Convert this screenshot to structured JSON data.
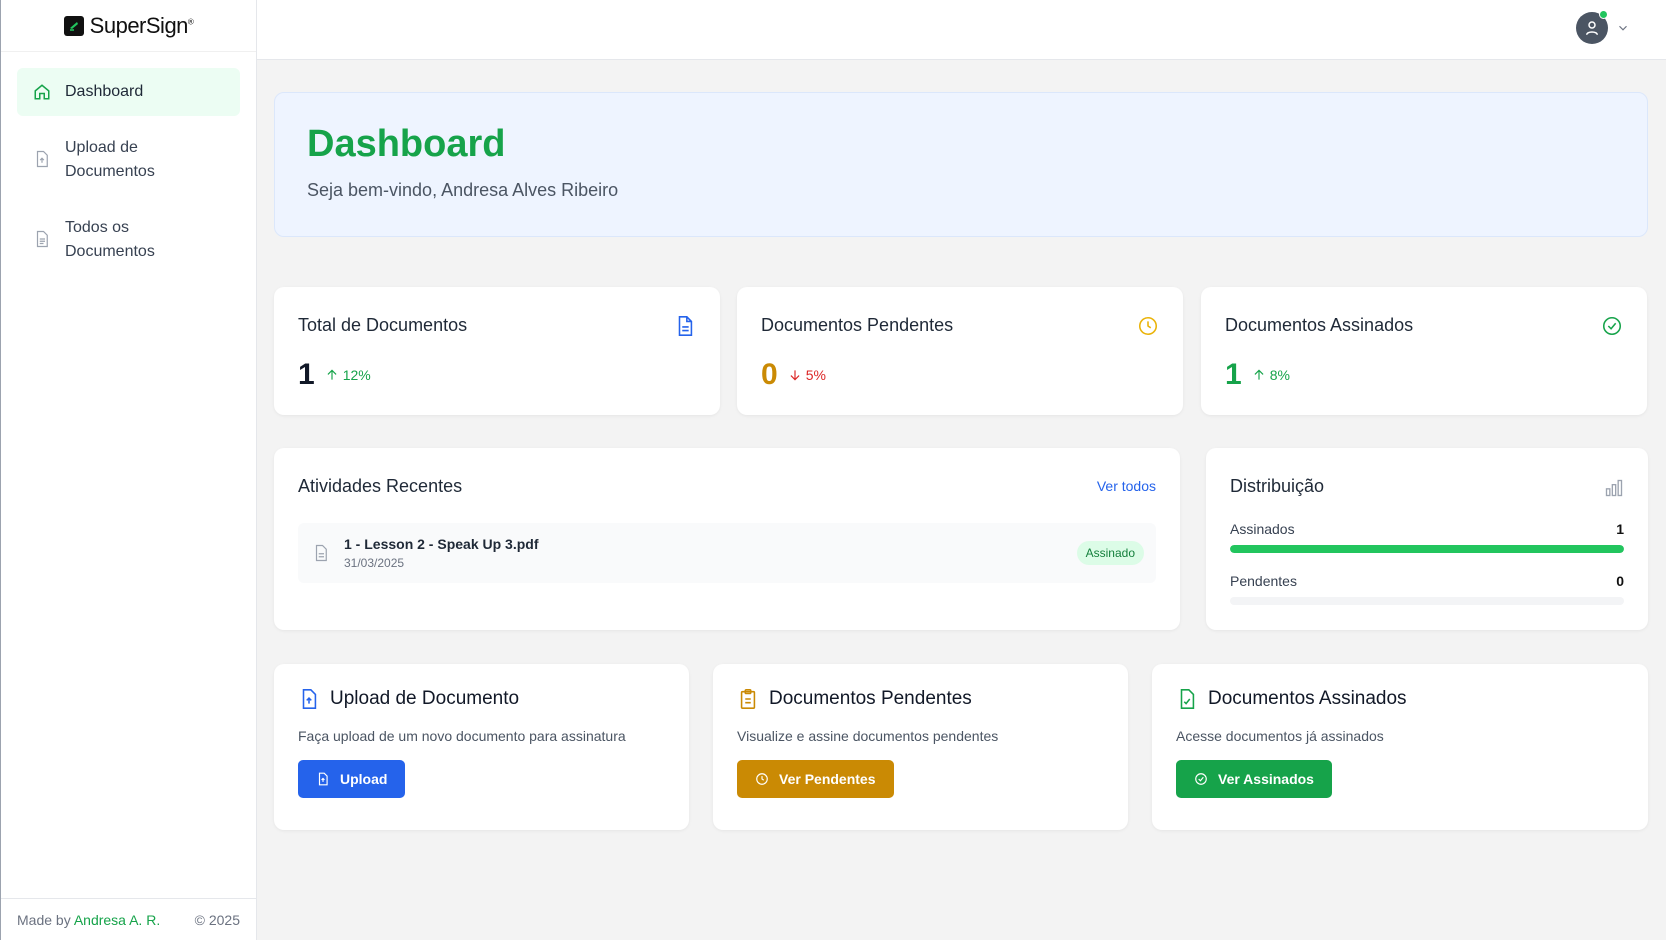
{
  "app": {
    "logo_text": "SuperSign",
    "logo_mark": "®"
  },
  "sidebar": {
    "items": [
      {
        "label": "Dashboard",
        "icon": "home-icon",
        "active": true
      },
      {
        "label": "Upload de Documentos",
        "icon": "file-upload-icon",
        "active": false
      },
      {
        "label": "Todos os Documentos",
        "icon": "file-text-icon",
        "active": false
      }
    ],
    "footer": {
      "made_by": "Made by",
      "author": "Andresa A. R.",
      "copyright": "© 2025"
    }
  },
  "hero": {
    "title": "Dashboard",
    "subtitle": "Seja bem-vindo, Andresa Alves Ribeiro"
  },
  "stats": [
    {
      "title": "Total de Documentos",
      "value": "1",
      "trend": "12%",
      "direction": "up",
      "value_color": "#111827",
      "trend_color": "#16a34a",
      "icon": "document-icon"
    },
    {
      "title": "Documentos Pendentes",
      "value": "0",
      "trend": "5%",
      "direction": "down",
      "value_color": "#ca8a04",
      "trend_color": "#dc2626",
      "icon": "clock-icon"
    },
    {
      "title": "Documentos Assinados",
      "value": "1",
      "trend": "8%",
      "direction": "up",
      "value_color": "#16a34a",
      "trend_color": "#16a34a",
      "icon": "check-circle-icon"
    }
  ],
  "activity": {
    "title": "Atividades Recentes",
    "view_all": "Ver todos",
    "items": [
      {
        "name": "1 - Lesson 2 - Speak Up 3.pdf",
        "date": "31/03/2025",
        "status": "Assinado"
      }
    ]
  },
  "distribution": {
    "title": "Distribuição",
    "rows": [
      {
        "label": "Assinados",
        "value": "1",
        "fraction": 1.0
      },
      {
        "label": "Pendentes",
        "value": "0",
        "fraction": 0.0
      }
    ]
  },
  "actions": [
    {
      "title": "Upload de Documento",
      "desc": "Faça upload de um novo documento para assinatura",
      "button": "Upload",
      "color": "#2563eb",
      "icon": "file-upload-icon"
    },
    {
      "title": "Documentos Pendentes",
      "desc": "Visualize e assine documentos pendentes",
      "button": "Ver Pendentes",
      "color": "#ca8a04",
      "icon": "clipboard-icon"
    },
    {
      "title": "Documentos Assinados",
      "desc": "Acesse documentos já assinados",
      "button": "Ver Assinados",
      "color": "#16a34a",
      "icon": "file-check-icon"
    }
  ]
}
